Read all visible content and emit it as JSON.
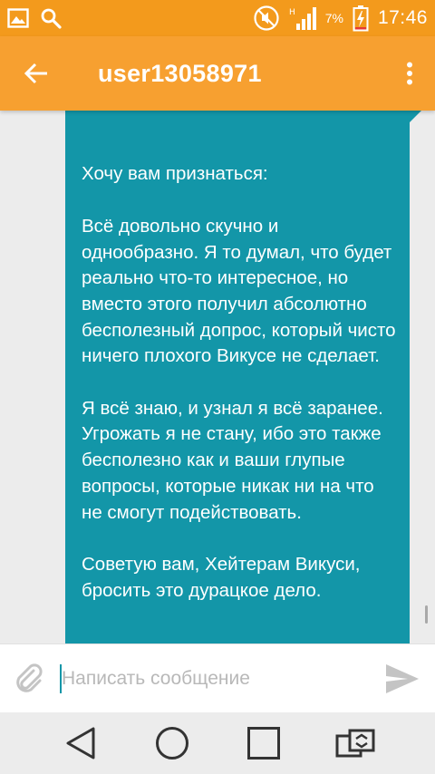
{
  "status_bar": {
    "battery_percent": "7%",
    "time": "17:46",
    "icons": [
      "gallery-icon",
      "search-icon",
      "mute-icon",
      "signal-icon",
      "battery-charging-icon"
    ]
  },
  "header": {
    "title": "user13058971",
    "back_icon": "arrow-back-icon",
    "menu_icon": "more-vert-icon"
  },
  "message": {
    "text": "Хочу вам признаться:\n\nВсё довольно скучно и однообразно. Я то думал, что будет реально что-то интересное, но вместо этого получил абсолютно бесполезный допрос, который чисто ничего плохого Викусе не сделает.\n\nЯ всё знаю, и узнал я всё заранее. Угрожать я не стану, ибо это также бесполезно как и ваши глупые вопросы, которые никак ни на что не смогут подействовать.\n\nСоветую вам, Хейтерам Викуси, бросить это дурацкое дело."
  },
  "composer": {
    "placeholder": "Написать сообщение",
    "value": ""
  },
  "nav": {
    "icons": [
      "back-triangle-icon",
      "home-circle-icon",
      "recents-square-icon",
      "switch-window-icon"
    ]
  },
  "colors": {
    "status_bar": "#f39a1c",
    "app_bar": "#f7a030",
    "bubble": "#1396a8",
    "background": "#ececec"
  }
}
